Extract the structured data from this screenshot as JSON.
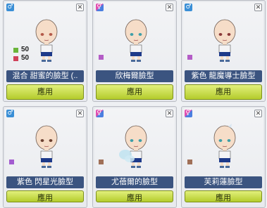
{
  "cards": [
    {
      "badge_icon": "male-icon",
      "badge_glyph": "♂",
      "name": "混合 甜蜜的臉型 (..",
      "apply_label": "應用",
      "stats": [
        {
          "color": "#6ab43a",
          "value": "50"
        },
        {
          "color": "#d0405a",
          "value": "50"
        }
      ],
      "eye_color": "#b45a4a"
    },
    {
      "badge_icon": "unisex-icon",
      "badge_glyph": "⚥",
      "name": "欣梅爾臉型",
      "apply_label": "應用",
      "swatch_color": "#b45cc6",
      "eye_color": "#3f9fa8"
    },
    {
      "badge_icon": "male-icon",
      "badge_glyph": "♂",
      "name": "紫色 龍魔導士臉型",
      "apply_label": "應用",
      "swatch_color": "#b45cc6",
      "eye_color": "#8a3a3a"
    },
    {
      "badge_icon": "male-icon",
      "badge_glyph": "♂",
      "name": "紫色 閃星光臉型",
      "apply_label": "應用",
      "swatch_color": "#a35cd0",
      "eye_color": "#6a4030"
    },
    {
      "badge_icon": "unisex-icon",
      "badge_glyph": "⚥",
      "name": "尤蓓爾的臉型",
      "apply_label": "應用",
      "swatch_color": "#a07058",
      "eye_color": "#3f9fa8"
    },
    {
      "badge_icon": "unisex-icon",
      "badge_glyph": "⚥",
      "name": "芙莉蓮臉型",
      "apply_label": "應用",
      "swatch_color": "#a07058",
      "eye_color": "#3f9fa8"
    }
  ],
  "close_glyph": "✕"
}
